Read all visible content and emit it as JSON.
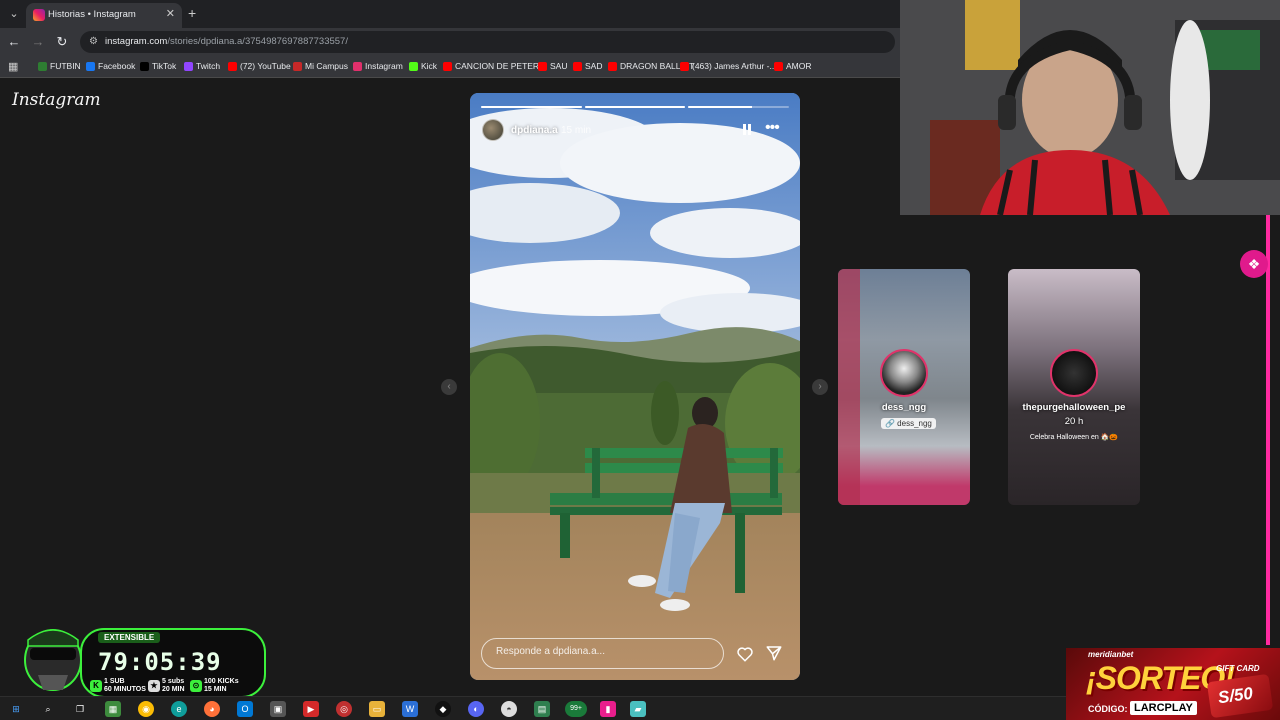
{
  "browser": {
    "tab_title": "Historias • Instagram",
    "url_host": "instagram.com",
    "url_path": "/stories/dpdiana.a/3754987697887733557/",
    "bookmarks": [
      {
        "label": "FUTBIN",
        "icon": "futbin-icon",
        "color": "#2e7d32"
      },
      {
        "label": "Facebook",
        "icon": "facebook-icon",
        "color": "#1877f2"
      },
      {
        "label": "TikTok",
        "icon": "tiktok-icon",
        "color": "#000000"
      },
      {
        "label": "Twitch",
        "icon": "twitch-icon",
        "color": "#9146ff"
      },
      {
        "label": "(72) YouTube",
        "icon": "youtube-icon",
        "color": "#ff0000"
      },
      {
        "label": "Mi Campus",
        "icon": "campus-icon",
        "color": "#c62828"
      },
      {
        "label": "Instagram",
        "icon": "instagram-icon",
        "color": "#e1306c"
      },
      {
        "label": "Kick",
        "icon": "kick-icon",
        "color": "#53fc18"
      },
      {
        "label": "CANCION DE PETER",
        "icon": "youtube-icon",
        "color": "#ff0000"
      },
      {
        "label": "SAU",
        "icon": "youtube-icon",
        "color": "#ff0000"
      },
      {
        "label": "SAD",
        "icon": "youtube-icon",
        "color": "#ff0000"
      },
      {
        "label": "DRAGON BALL GT",
        "icon": "youtube-icon",
        "color": "#ff0000"
      },
      {
        "label": "(463) James Arthur -...",
        "icon": "youtube-icon",
        "color": "#ff0000"
      },
      {
        "label": "AMOR",
        "icon": "youtube-icon",
        "color": "#ff0000"
      }
    ]
  },
  "instagram": {
    "logo": "Instagram",
    "story": {
      "username": "dpdiana.a",
      "time": "15 min",
      "progress": [
        1.0,
        1.0,
        0.63
      ],
      "reply_placeholder": "Responde a dpdiana.a..."
    },
    "next_stories": [
      {
        "username": "dess_ngg",
        "sticker": "🔗 dess_ngg"
      },
      {
        "username": "thepurgehalloween_pe",
        "time": "20 h",
        "caption": "Celebra Halloween en 🏠🎃"
      }
    ]
  },
  "overlay": {
    "timer_label": "EXTENSIBLE",
    "timer_value": "79:05:39",
    "stats": [
      {
        "line1": "1 SUB",
        "line2": "60 MINUTOS"
      },
      {
        "line1": "5 subs",
        "line2": "20 MIN"
      },
      {
        "line1": "100 KICKs",
        "line2": "15 MIN"
      }
    ],
    "sorteo_brand": "meridianbet",
    "sorteo_title": "¡SORTEO!",
    "sorteo_code_label": "CÓDIGO:",
    "sorteo_code": "LARCPLAY",
    "gift_card_label": "GIFT CARD",
    "gift_card_value": "S/50"
  },
  "taskbar": {
    "badge": "99+"
  }
}
